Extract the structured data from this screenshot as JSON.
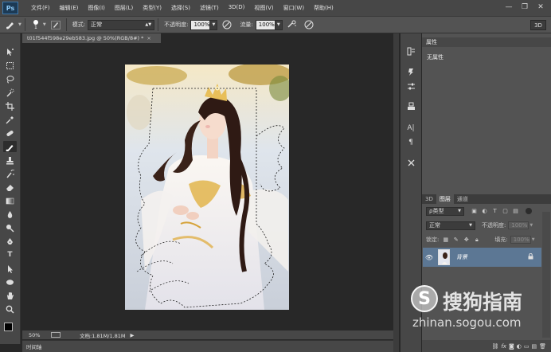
{
  "menubar": {
    "logo": "Ps",
    "items": [
      "文件(F)",
      "编辑(E)",
      "图像(I)",
      "图层(L)",
      "类型(Y)",
      "选择(S)",
      "滤镜(T)",
      "3D(D)",
      "视图(V)",
      "窗口(W)",
      "帮助(H)"
    ],
    "window_buttons": [
      "—",
      "❐",
      "✕"
    ]
  },
  "options": {
    "brush_size": "1",
    "mode_label": "模式:",
    "mode_value": "正常",
    "opacity_label": "不透明度:",
    "opacity_value": "100%",
    "flow_label": "流量:",
    "flow_value": "100%",
    "btn_3d": "3D"
  },
  "document": {
    "tab_title": "t01f544f598e29eb583.jpg @ 50%(RGB/8#) *",
    "tab_close": "×",
    "zoom": "50%",
    "doc_size": "文档:1.81M/1.81M",
    "status_arrow": "▶"
  },
  "timeline": {
    "label": "时间轴"
  },
  "properties": {
    "title": "属性",
    "empty_text": "无属性"
  },
  "layers": {
    "tabs": [
      "3D",
      "图层",
      "通道"
    ],
    "filter_kind": "ρ类型",
    "blend_mode": "正常",
    "opacity_label": "不透明度:",
    "opacity_value": "100%",
    "lock_label": "锁定:",
    "fill_label": "填充:",
    "fill_value": "100%",
    "layer_name": "背景"
  },
  "watermark": {
    "logo": "S",
    "text": "搜狗指南",
    "url": "zhinan.sogou.com"
  },
  "colors": {
    "selected_layer": "#5c7794",
    "panel_bg": "#535353",
    "canvas_bg": "#282828"
  }
}
